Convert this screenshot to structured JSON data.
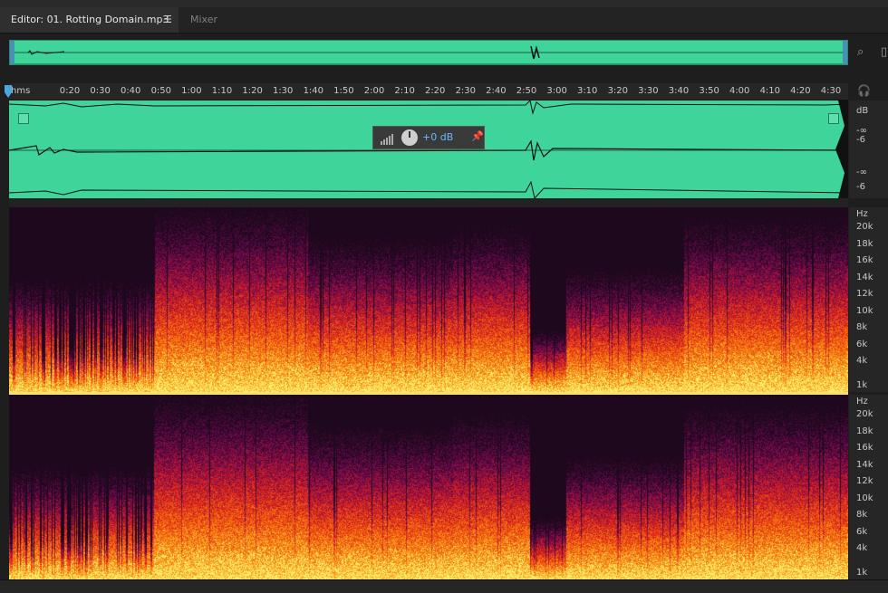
{
  "tabs": {
    "editor_label": "Editor: 01. Rotting Domain.mp3",
    "menu_icon": "☰",
    "mixer_label": "Mixer"
  },
  "ruler": {
    "unit_label": "hms",
    "ticks": [
      "0:20",
      "0:30",
      "0:40",
      "0:50",
      "1:00",
      "1:10",
      "1:20",
      "1:30",
      "1:40",
      "1:50",
      "2:00",
      "2:10",
      "2:20",
      "2:30",
      "2:40",
      "2:50",
      "3:00",
      "3:10",
      "3:20",
      "3:30",
      "3:40",
      "3:50",
      "4:00",
      "4:10",
      "4:20",
      "4:30"
    ]
  },
  "hud": {
    "volume_label": "+0 dB"
  },
  "db_scale": {
    "unit": "dB",
    "labels": [
      "-∞",
      "-6",
      "-∞",
      "-6"
    ]
  },
  "hz_scale": {
    "unit": "Hz",
    "labels": [
      "20k",
      "18k",
      "16k",
      "14k",
      "12k",
      "10k",
      "8k",
      "6k",
      "4k",
      "1k"
    ]
  },
  "colors": {
    "waveform_bg": "#3fd59a",
    "accent": "#4aa8e0",
    "spectral_high": "#f7e07a",
    "spectral_mid": "#e0301a",
    "spectral_low": "#1a0a22"
  }
}
